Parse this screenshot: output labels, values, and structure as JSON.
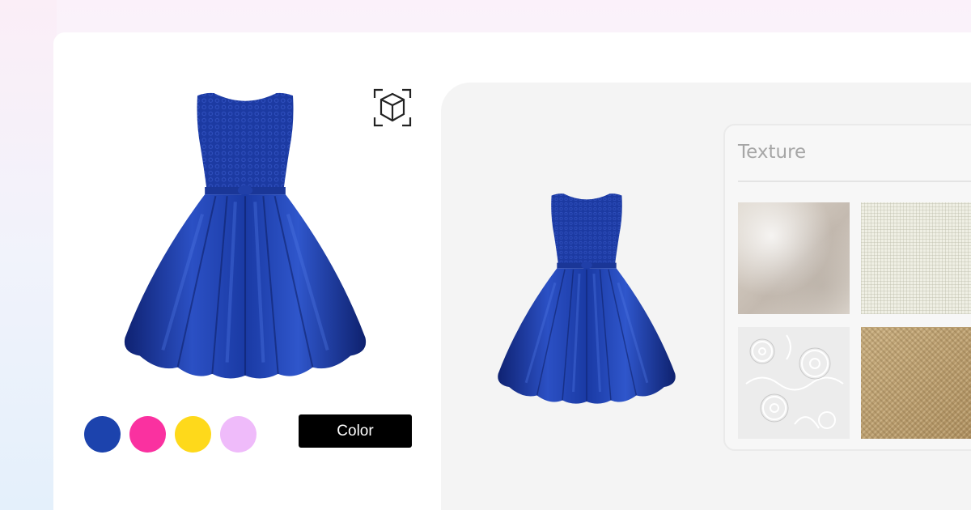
{
  "colors": {
    "dress": "#1d3ea8",
    "dress_dark": "#0f2272",
    "dress_light": "#3f63d6"
  },
  "ar_view": {
    "icon": "ar-cube-icon"
  },
  "swatches": [
    {
      "name": "blue",
      "color": "#1c43ad"
    },
    {
      "name": "pink",
      "color": "#fa31a0"
    },
    {
      "name": "yellow",
      "color": "#fed91b"
    },
    {
      "name": "lavender",
      "color": "#efbbfa"
    }
  ],
  "color_button": {
    "label": "Color"
  },
  "texture_panel": {
    "title": "Texture",
    "tiles": [
      "wool",
      "linen",
      "lace",
      "canvas"
    ]
  }
}
